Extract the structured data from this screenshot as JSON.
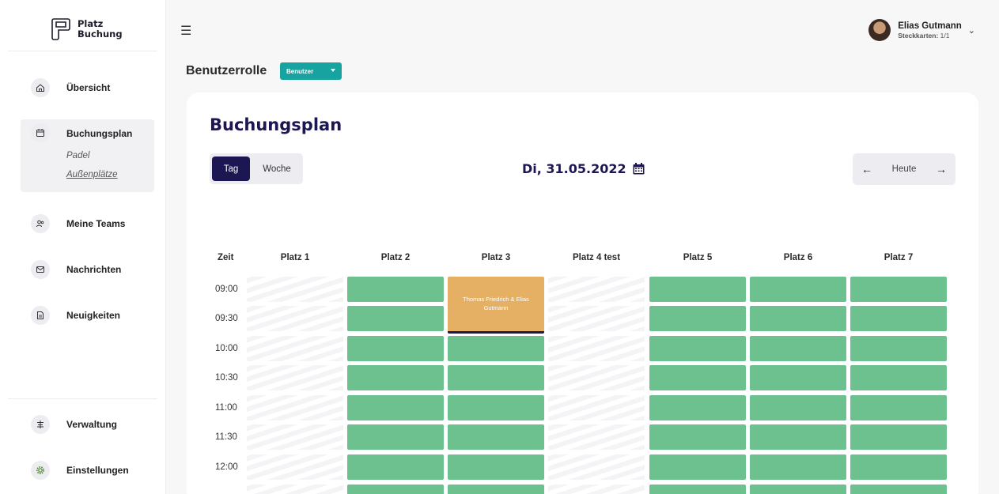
{
  "app": {
    "logo_line1": "Platz",
    "logo_line2": "Buchung"
  },
  "sidebar": {
    "items": [
      {
        "label": "Übersicht",
        "icon": "home-icon"
      },
      {
        "label": "Buchungsplan",
        "icon": "calendar-icon",
        "active": true,
        "subitems": [
          "Padel",
          "Außenplätze"
        ]
      },
      {
        "label": "Meine Teams",
        "icon": "users-icon"
      },
      {
        "label": "Nachrichten",
        "icon": "mail-icon"
      },
      {
        "label": "Neuigkeiten",
        "icon": "document-icon"
      }
    ],
    "bottom_items": [
      {
        "label": "Verwaltung",
        "icon": "sliders-icon"
      },
      {
        "label": "Einstellungen",
        "icon": "gear-icon"
      }
    ]
  },
  "topbar": {
    "user_name": "Elias Gutmann",
    "user_sub_label": "Steckkarten:",
    "user_sub_value": "1/1"
  },
  "role": {
    "label": "Benutzerrolle",
    "selected": "Benutzer"
  },
  "schedule": {
    "title": "Buchungsplan",
    "view_day": "Tag",
    "view_week": "Woche",
    "date": "Di, 31.05.2022",
    "today_label": "Heute",
    "time_header": "Zeit",
    "courts": [
      "Platz 1",
      "Platz 2",
      "Platz 3",
      "Platz 4 test",
      "Platz 5",
      "Platz 6",
      "Platz 7"
    ],
    "times": [
      "09:00",
      "09:30",
      "10:00",
      "10:30",
      "11:00",
      "11:30",
      "12:00"
    ],
    "booking": {
      "court": "Platz 3",
      "start": "09:00",
      "end": "10:00",
      "text": "Thomas Friedrich & Elias Gutmann"
    }
  },
  "colors": {
    "primary": "#1c1652",
    "accent": "#17a3a0",
    "free_slot": "#6cc18f",
    "booked_slot": "#e5b063"
  }
}
